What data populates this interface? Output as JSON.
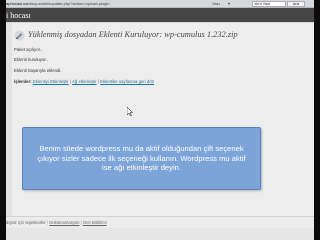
{
  "browser": {
    "url_host": "aphocasi.com",
    "url_path": "/wp-admin/update.php?action=upload-plugin",
    "menu_items": [
      "Yazı",
      "▾"
    ],
    "search_value": "Yeni Yazı",
    "search_button": "Ara"
  },
  "wp": {
    "site_title": "i hocası",
    "page_title": "Yüklenmiş dosyadan Eklenti Kuruluyor: wp-cumulus 1.232.zip",
    "log": [
      "Paket açılıyor..",
      "Eklenti kuruluyor..",
      "Eklenti başarıyla eklendi."
    ],
    "actions": {
      "label": "İşlemler:",
      "links": [
        "Eklentiyi Etkinleştir",
        "Ağ etkinleştir",
        "Eklentiler sayfasına geri dön"
      ]
    }
  },
  "note": {
    "text": "Benim sitede wordpress mu da aktif olduğundan çift seçenek çıkıyor sizler sadece ilk seçeneği kullanın. Wordpress mu aktif ise ağı etkinleştir deyin."
  },
  "footer": {
    "prefix": "dışsiz için teşekkürler",
    "links": [
      "Dokümantasyon",
      "Geri Bildirimi"
    ]
  }
}
